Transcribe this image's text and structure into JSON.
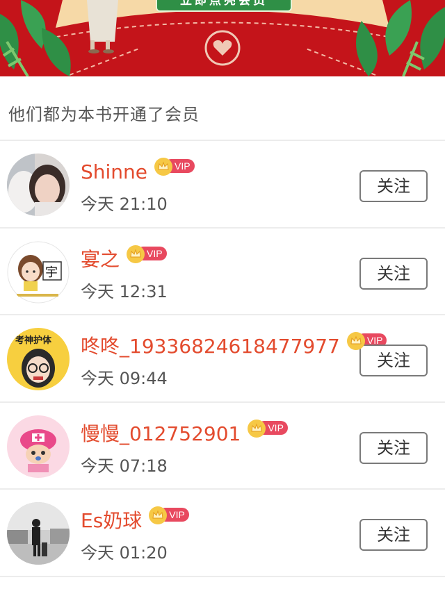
{
  "banner": {
    "cta_label": "立即点亮会员",
    "background": "#c4141a",
    "icons": [
      "leaf-icon",
      "heart-seal-icon"
    ]
  },
  "section": {
    "title": "他们都为本书开通了会员"
  },
  "vip_badge": {
    "label": "VIP",
    "icon": "crown-icon",
    "color": "#e8495f"
  },
  "follow_label": "关注",
  "members": [
    {
      "name": "Shinne",
      "time": "今天 21:10",
      "avatar": "avatar-girl-with-cat"
    },
    {
      "name": "宴之",
      "time": "今天 12:31",
      "avatar": "avatar-cartoon-girl-yu",
      "avatar_text": "宇"
    },
    {
      "name": "咚咚_19336824618477977",
      "time": "今天 09:44",
      "avatar": "avatar-cartoon-glasses",
      "avatar_text": "考神护体"
    },
    {
      "name": "慢慢_012752901",
      "time": "今天 07:18",
      "avatar": "avatar-chopper-cartoon"
    },
    {
      "name": "Es奶球",
      "time": "今天 01:20",
      "avatar": "avatar-street-photo"
    }
  ],
  "colors": {
    "name": "#e34b2e",
    "follow_border": "#7a7a7a"
  }
}
